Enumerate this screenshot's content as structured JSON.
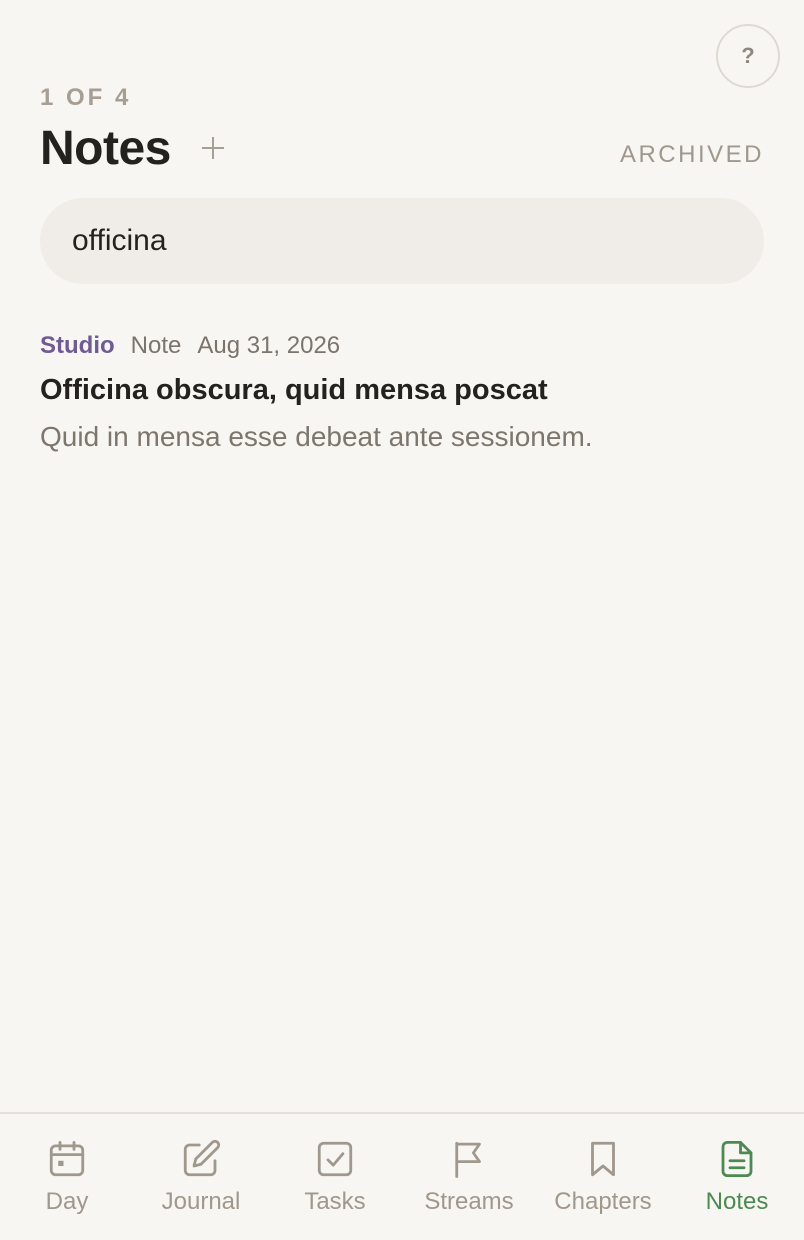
{
  "header": {
    "counter": "1 OF 4",
    "title": "Notes",
    "archived_label": "ARCHIVED",
    "help_label": "?"
  },
  "search": {
    "value": "officina"
  },
  "results": [
    {
      "project": "Studio",
      "type": "Note",
      "date": "Aug 31, 2026",
      "title": "Officina obscura, quid mensa poscat",
      "snippet": "Quid in mensa esse debeat ante sessionem."
    }
  ],
  "tabs": [
    {
      "label": "Day",
      "icon": "calendar-icon"
    },
    {
      "label": "Journal",
      "icon": "edit-icon"
    },
    {
      "label": "Tasks",
      "icon": "checkbox-icon"
    },
    {
      "label": "Streams",
      "icon": "flag-icon"
    },
    {
      "label": "Chapters",
      "icon": "bookmark-icon"
    },
    {
      "label": "Notes",
      "icon": "document-icon",
      "active": true
    }
  ],
  "colors": {
    "background": "#f8f6f2",
    "accent": "#4c8a52",
    "project": "#6f5a94",
    "muted": "#a0978d"
  }
}
